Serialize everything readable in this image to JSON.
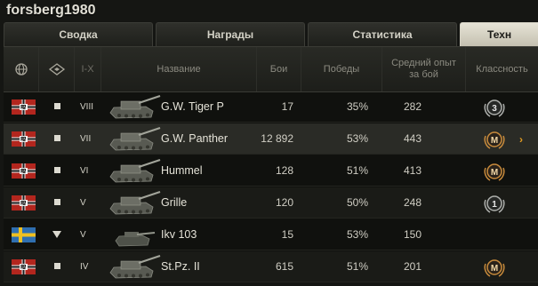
{
  "player": {
    "name": "forsberg1980"
  },
  "tabs": [
    {
      "label": "Сводка",
      "active": false
    },
    {
      "label": "Награды",
      "active": false
    },
    {
      "label": "Статистика",
      "active": false
    },
    {
      "label": "Техн",
      "active": true
    }
  ],
  "headers": {
    "nation": "globe-icon",
    "type": "vehicle-type-icon",
    "tier": "I-X",
    "name": "Название",
    "battles": "Бои",
    "wins": "Победы",
    "avg_xp": "Средний опыт за бой",
    "mastery": "Классность"
  },
  "rows": [
    {
      "nation": "germany",
      "type": "spg",
      "tier": "VIII",
      "name": "G.W. Tiger P",
      "battles": "17",
      "wins": "35%",
      "avg_xp": "282",
      "mastery": "3",
      "selected": false
    },
    {
      "nation": "germany",
      "type": "spg",
      "tier": "VII",
      "name": "G.W. Panther",
      "battles": "12 892",
      "wins": "53%",
      "avg_xp": "443",
      "mastery": "M",
      "selected": true
    },
    {
      "nation": "germany",
      "type": "spg",
      "tier": "VI",
      "name": "Hummel",
      "battles": "128",
      "wins": "51%",
      "avg_xp": "413",
      "mastery": "M",
      "selected": false
    },
    {
      "nation": "germany",
      "type": "spg",
      "tier": "V",
      "name": "Grille",
      "battles": "120",
      "wins": "50%",
      "avg_xp": "248",
      "mastery": "1",
      "selected": false
    },
    {
      "nation": "sweden",
      "type": "td",
      "tier": "V",
      "name": "Ikv 103",
      "battles": "15",
      "wins": "53%",
      "avg_xp": "150",
      "mastery": "",
      "selected": false
    },
    {
      "nation": "germany",
      "type": "spg",
      "tier": "IV",
      "name": "St.Pz. II",
      "battles": "615",
      "wins": "51%",
      "avg_xp": "201",
      "mastery": "M",
      "selected": false
    }
  ],
  "colors": {
    "accent": "#e09b22",
    "active_tab": "#d8d5c7"
  }
}
